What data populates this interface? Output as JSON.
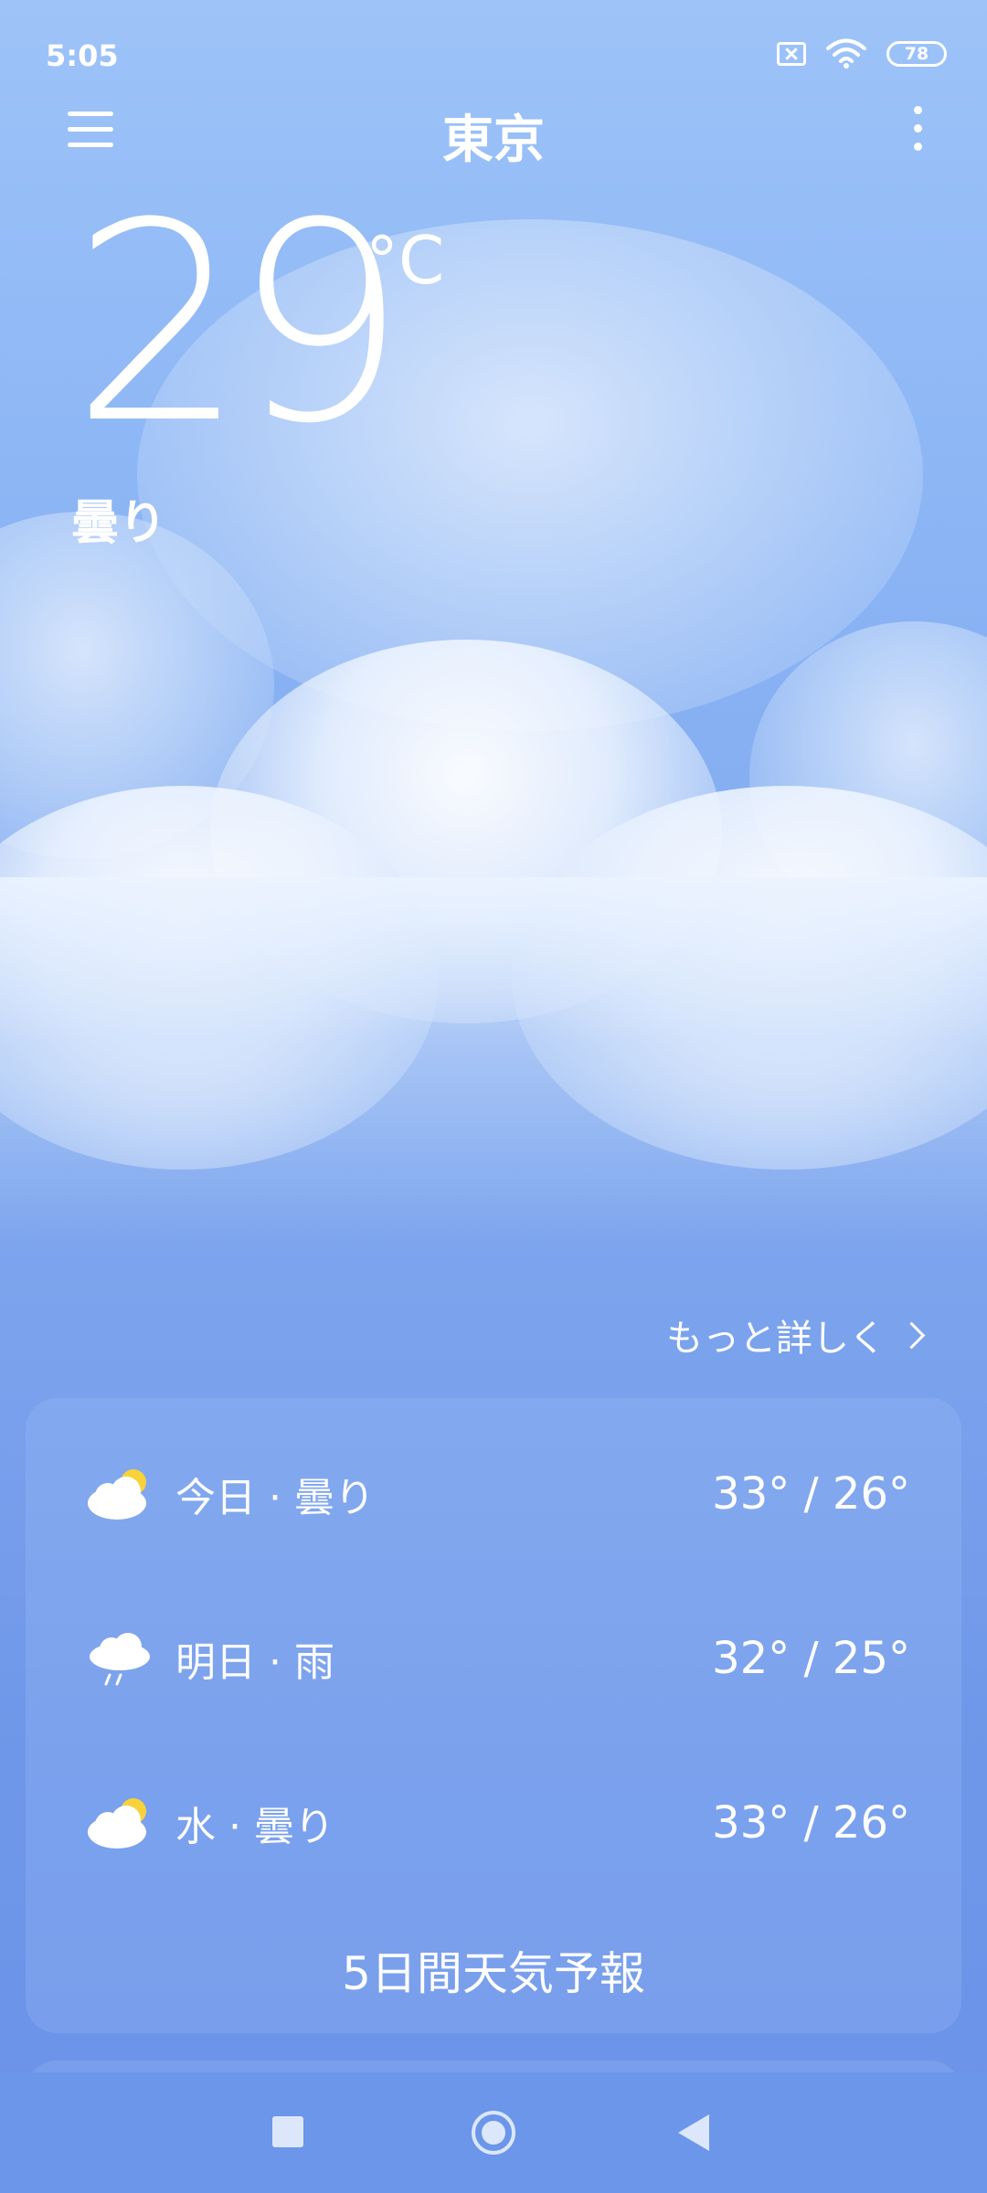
{
  "status_bar": {
    "time": "5:05",
    "battery": "78",
    "icons": [
      "sim-off-icon",
      "wifi-icon",
      "battery-icon"
    ]
  },
  "header": {
    "city": "東京",
    "menu_icon": "hamburger-menu-icon",
    "more_icon": "more-vert-icon"
  },
  "current": {
    "temperature": "29",
    "unit": "°C",
    "condition": "曇り"
  },
  "more_details": {
    "label": "もっと詳しく"
  },
  "forecast": {
    "days": [
      {
        "label": "今日 · 曇り",
        "temps": "33° / 26°",
        "icon": "partly-cloudy-icon"
      },
      {
        "label": "明日 · 雨",
        "temps": "32° / 25°",
        "icon": "rain-icon"
      },
      {
        "label": "水 · 曇り",
        "temps": "33° / 26°",
        "icon": "partly-cloudy-icon"
      }
    ],
    "five_day_label": "5日間天気予報"
  },
  "colors": {
    "sky_top": "#9dc3f8",
    "sky_bottom": "#6a92e8",
    "text": "#ffffff",
    "sun": "#f7d23a"
  }
}
